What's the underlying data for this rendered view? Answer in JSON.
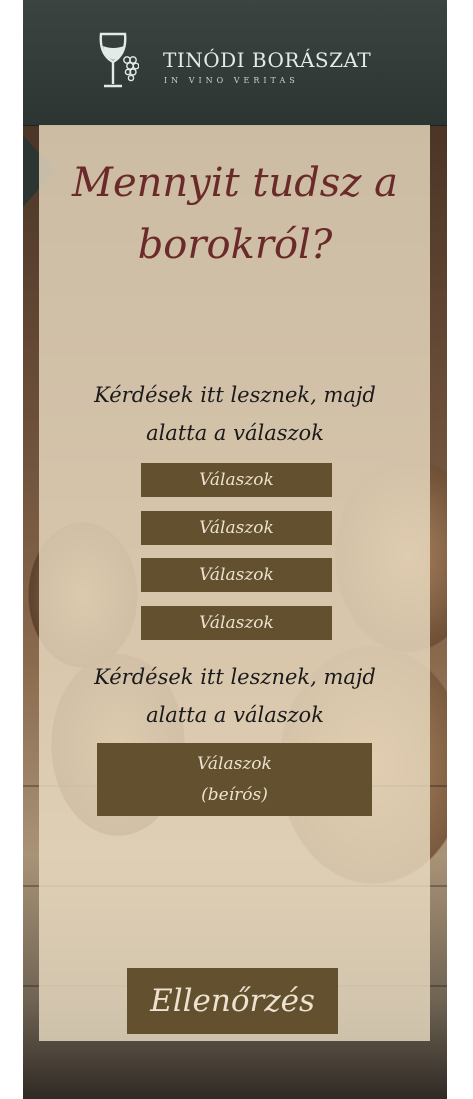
{
  "header": {
    "brand": "TINÓDI BORÁSZAT",
    "tagline": "IN VINO VERITAS",
    "logo_icon": "wine-glass-grapes-icon"
  },
  "quiz": {
    "title_line1": "Mennyit tudsz a",
    "title_line2": "borokról?",
    "question1": {
      "line1": "Kérdések itt lesznek, majd",
      "line2": "alatta a válaszok",
      "answers": [
        "Válaszok",
        "Válaszok",
        "Válaszok",
        "Válaszok"
      ]
    },
    "question2": {
      "line1": "Kérdések itt lesznek, majd",
      "line2": "alatta a válaszok",
      "text_answer_line1": "Válaszok",
      "text_answer_line2": "(beírós)"
    },
    "check_button": "Ellenőrzés"
  },
  "colors": {
    "header_bg": "#343c3a",
    "title": "#6b2a2a",
    "button_bg": "#63502f",
    "button_text": "#ece2cf",
    "panel_overlay": "#ecdec4"
  }
}
